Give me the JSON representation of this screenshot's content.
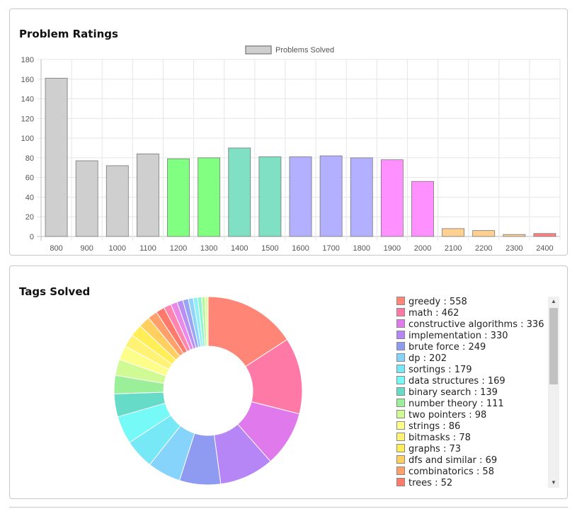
{
  "ratings_card": {
    "title": "Problem Ratings"
  },
  "tags_card": {
    "title": "Tags Solved"
  },
  "chart_data": [
    {
      "type": "bar",
      "title": "Problem Ratings",
      "legend": {
        "label": "Problems Solved",
        "placement": "top-center"
      },
      "categories": [
        "800",
        "900",
        "1000",
        "1100",
        "1200",
        "1300",
        "1400",
        "1500",
        "1600",
        "1700",
        "1800",
        "1900",
        "2000",
        "2100",
        "2200",
        "2300",
        "2400"
      ],
      "values": [
        161,
        77,
        72,
        84,
        79,
        80,
        90,
        81,
        81,
        82,
        80,
        78,
        56,
        8,
        6,
        2,
        3
      ],
      "colors": [
        "#cfcfcf",
        "#cfcfcf",
        "#cfcfcf",
        "#cfcfcf",
        "#80ff80",
        "#80ff80",
        "#80e0c4",
        "#80e0c4",
        "#b3b0ff",
        "#b3b0ff",
        "#b3b0ff",
        "#ff90ff",
        "#ff90ff",
        "#ffd090",
        "#ffd090",
        "#ffd090",
        "#ff8080"
      ],
      "ylim": [
        0,
        180
      ],
      "yticks": [
        0,
        20,
        40,
        60,
        80,
        100,
        120,
        140,
        160,
        180
      ],
      "grid": true
    },
    {
      "type": "pie",
      "title": "Tags Solved",
      "donut": true,
      "legend_placement": "right",
      "slices": [
        {
          "label": "greedy",
          "value": 558,
          "color": "#ff8577"
        },
        {
          "label": "math",
          "value": 462,
          "color": "#ff79a6"
        },
        {
          "label": "constructive algorithms",
          "value": 336,
          "color": "#e079ec"
        },
        {
          "label": "implementation",
          "value": 330,
          "color": "#b685f6"
        },
        {
          "label": "brute force",
          "value": 249,
          "color": "#8f9bf0"
        },
        {
          "label": "dp",
          "value": 202,
          "color": "#86d3fb"
        },
        {
          "label": "sortings",
          "value": 179,
          "color": "#76e8f6"
        },
        {
          "label": "data structures",
          "value": 169,
          "color": "#76faf8"
        },
        {
          "label": "binary search",
          "value": 139,
          "color": "#66dbc8"
        },
        {
          "label": "number theory",
          "value": 111,
          "color": "#9bef98"
        },
        {
          "label": "two pointers",
          "value": 98,
          "color": "#d0fb94"
        },
        {
          "label": "strings",
          "value": 86,
          "color": "#fdfd8a"
        },
        {
          "label": "bitmasks",
          "value": 78,
          "color": "#fff275"
        },
        {
          "label": "graphs",
          "value": 73,
          "color": "#ffee55"
        },
        {
          "label": "dfs and similar",
          "value": 69,
          "color": "#ffd060"
        },
        {
          "label": "combinatorics",
          "value": 58,
          "color": "#ffa06a"
        },
        {
          "label": "trees",
          "value": 52,
          "color": "#ff7a6a"
        },
        {
          "label": "",
          "value": 45,
          "color": "#ff85b0"
        },
        {
          "label": "",
          "value": 40,
          "color": "#e98ae8"
        },
        {
          "label": "",
          "value": 36,
          "color": "#b88ff2"
        },
        {
          "label": "",
          "value": 33,
          "color": "#98a4f4"
        },
        {
          "label": "",
          "value": 30,
          "color": "#8fd4fb"
        },
        {
          "label": "",
          "value": 27,
          "color": "#8ff0f6"
        },
        {
          "label": "",
          "value": 24,
          "color": "#8df4cf"
        },
        {
          "label": "",
          "value": 21,
          "color": "#b9f69e"
        },
        {
          "label": "",
          "value": 18,
          "color": "#e2fb9a"
        }
      ],
      "visible_legend_count": 17
    }
  ]
}
